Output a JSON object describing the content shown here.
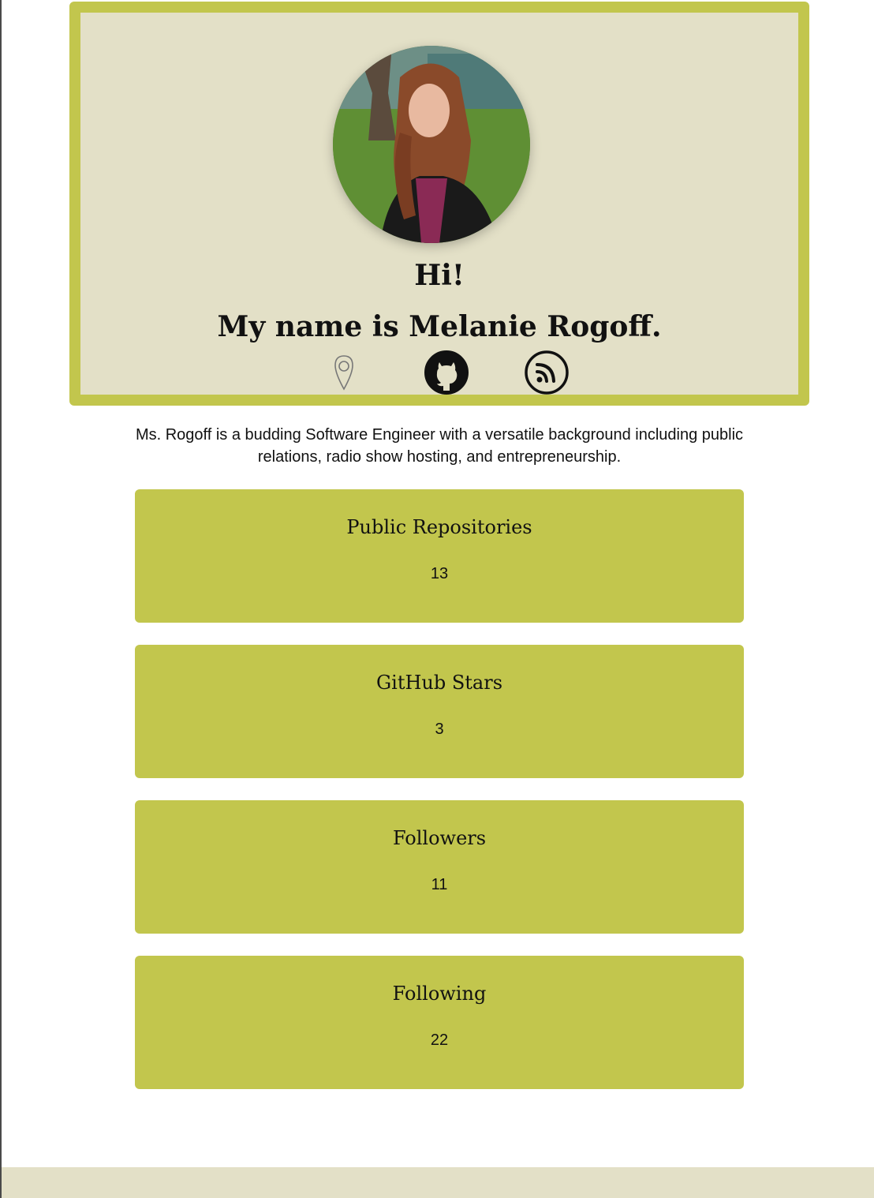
{
  "hero": {
    "greeting": "Hi!",
    "name_line": "My name is Melanie Rogoff."
  },
  "links": [
    {
      "icon": "location-pin-icon",
      "label": "Location"
    },
    {
      "icon": "github-icon",
      "label": "GitHub"
    },
    {
      "icon": "rss-feed-icon",
      "label": "Blog"
    }
  ],
  "bio": "Ms. Rogoff is a budding Software Engineer with a versatile background including public relations, radio show hosting, and entrepreneurship.",
  "stats": [
    {
      "title": "Public Repositories",
      "value": "13"
    },
    {
      "title": "GitHub Stars",
      "value": "3"
    },
    {
      "title": "Followers",
      "value": "11"
    },
    {
      "title": "Following",
      "value": "22"
    }
  ],
  "colors": {
    "accent": "#c2c64d",
    "panel": "#e3e0c7",
    "text": "#111111"
  }
}
